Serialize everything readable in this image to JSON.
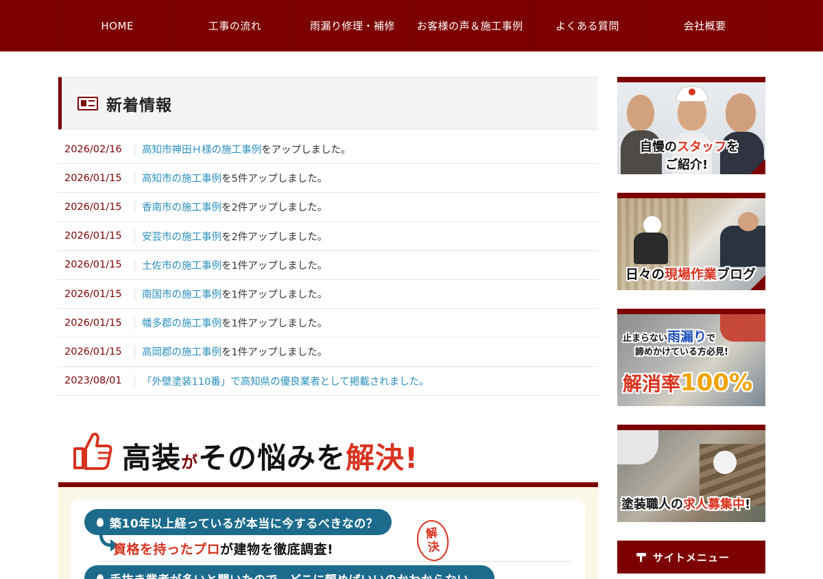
{
  "nav": {
    "items": [
      {
        "label": "HOME"
      },
      {
        "label": "工事の流れ"
      },
      {
        "label": "雨漏り修理・補修"
      },
      {
        "label": "お客様の声＆施工事例"
      },
      {
        "label": "よくある質問"
      },
      {
        "label": "会社概要"
      }
    ]
  },
  "news": {
    "title": "新着情報",
    "items": [
      {
        "date": "2026/02/16",
        "link": "高知市神田Ｈ様の施工事例",
        "rest": "をアップしました。"
      },
      {
        "date": "2026/01/15",
        "link": "高知市の施工事例",
        "rest": "を5件アップしました。"
      },
      {
        "date": "2026/01/15",
        "link": "香南市の施工事例",
        "rest": "を2件アップしました。"
      },
      {
        "date": "2026/01/15",
        "link": "安芸市の施工事例",
        "rest": "を2件アップしました。"
      },
      {
        "date": "2026/01/15",
        "link": "土佐市の施工事例",
        "rest": "を1件アップしました。"
      },
      {
        "date": "2026/01/15",
        "link": "南国市の施工事例",
        "rest": "を1件アップしました。"
      },
      {
        "date": "2026/01/15",
        "link": "幡多郡の施工事例",
        "rest": "を1件アップしました。"
      },
      {
        "date": "2026/01/15",
        "link": "高岡郡の施工事例",
        "rest": "を1件アップしました。"
      },
      {
        "date": "2023/08/01",
        "link": "「外壁塗装110番」で高知県の優良業者として掲載されました。",
        "rest": ""
      }
    ]
  },
  "solve": {
    "part1": "高装",
    "part2": "が",
    "part3": "その悩みを",
    "part4": "解決",
    "part5": "!"
  },
  "faq": {
    "q1": "築10年以上経っているが本当に今するべきなの？",
    "a1_red": "資格を持ったプロ",
    "a1_rest": "が建物を徹底調査!",
    "stamp_1": "解",
    "stamp_2": "決",
    "q2": "手抜き業者が多いと聞いたので、どこに頼めばいいのかわからない…"
  },
  "sidebar": {
    "b1": {
      "p1": "自慢の",
      "p2": "スタッフ",
      "p3": "を",
      "p4": "ご紹介!"
    },
    "b2": {
      "p1": "日々の",
      "p2": "現場作業",
      "p3": "ブログ"
    },
    "b3": {
      "p1": "止まらない",
      "p2": "雨漏り",
      "p3": "で",
      "p4": "諦めかけている方必見!",
      "p5": "解消率",
      "p6": "100%"
    },
    "b4": {
      "p1": "塗装職人の",
      "p2": "求人募集中",
      "p3": "!"
    },
    "menu_label": "サイトメニュー"
  }
}
